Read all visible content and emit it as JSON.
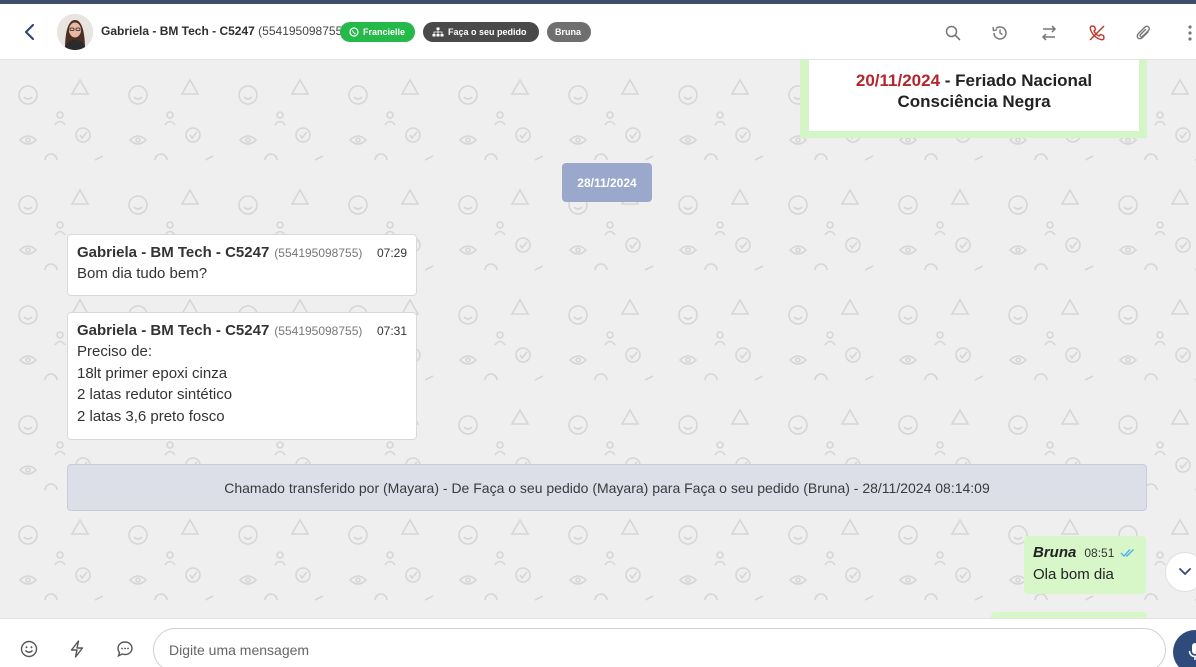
{
  "header": {
    "contact_name": "Gabriela - BM Tech - C5247",
    "contact_phone": "(554195098755)",
    "tags": [
      {
        "label": "Francielle",
        "color": "#25b94a",
        "icon": "whatsapp-icon"
      },
      {
        "label": "Faça o seu pedido",
        "color": "#4a4a4a",
        "icon": "org-chart-icon"
      },
      {
        "label": "Bruna",
        "color": "#6f6f6f"
      }
    ],
    "actions": [
      "search-icon",
      "history-icon",
      "transfer-icon",
      "hangup-icon",
      "attachment-icon",
      "more-icon"
    ]
  },
  "notice": {
    "date": "20/11/2024",
    "text_line1": " - Feriado Nacional",
    "text_line2": "Consciência Negra"
  },
  "date_separator": "28/11/2024",
  "messages_in": [
    {
      "sender": "Gabriela - BM Tech - C5247",
      "phone": "(554195098755)",
      "time": "07:29",
      "lines": [
        "Bom dia tudo bem?"
      ]
    },
    {
      "sender": "Gabriela - BM Tech - C5247",
      "phone": "(554195098755)",
      "time": "07:31",
      "lines": [
        "Preciso de:",
        "18lt primer epoxi cinza",
        "2 latas redutor sintético",
        "2 latas 3,6 preto fosco"
      ]
    }
  ],
  "system_message": "Chamado transferido por (Mayara) - De Faça o seu pedido (Mayara) para Faça o seu pedido (Bruna) - 28/11/2024 08:14:09",
  "message_out": {
    "sender": "Bruna",
    "time": "08:51",
    "status": "read",
    "text": "Ola bom dia"
  },
  "footer": {
    "placeholder": "Digite uma mensagem"
  },
  "colors": {
    "accent": "#2f4b7c",
    "outgoing_bubble": "#d8f7c9",
    "date_chip": "#9aa8cc",
    "notice_date": "#b3262b"
  }
}
